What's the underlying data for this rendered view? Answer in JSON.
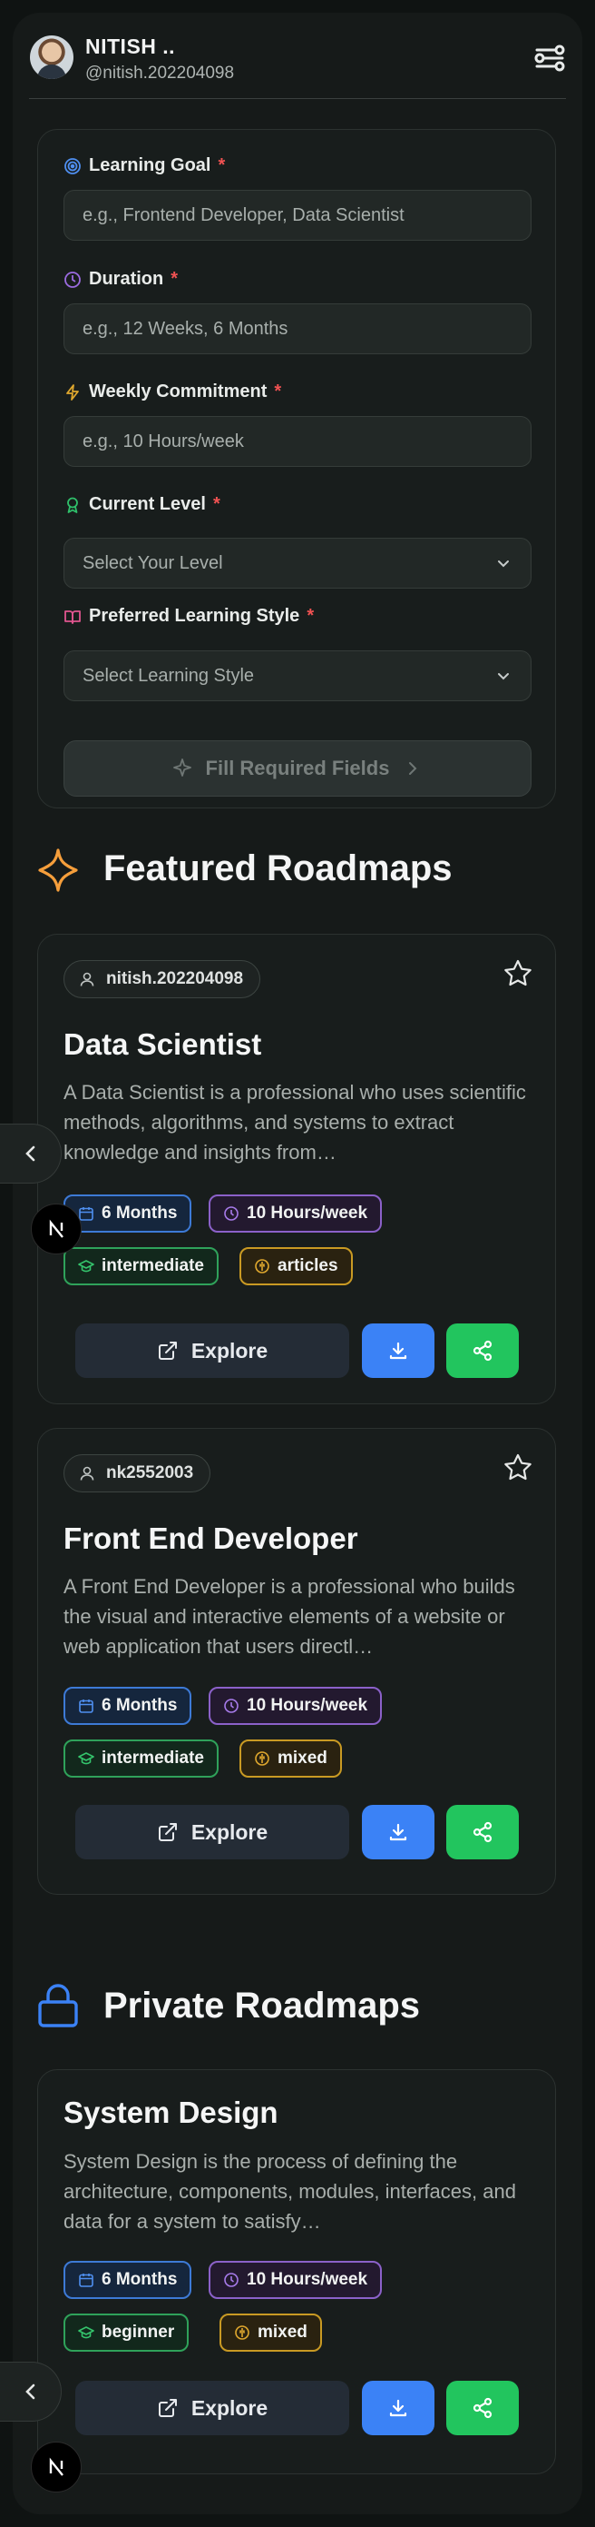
{
  "user": {
    "name": "NITISH ..",
    "handle": "@nitish.202204098"
  },
  "form": {
    "fields": [
      {
        "label": "Learning Goal",
        "required": "*",
        "placeholder": "e.g., Frontend Developer, Data Scientist",
        "icon": "target-icon"
      },
      {
        "label": "Duration",
        "required": "*",
        "placeholder": "e.g., 12 Weeks, 6 Months",
        "icon": "clock-icon"
      },
      {
        "label": "Weekly Commitment",
        "required": "*",
        "placeholder": "e.g., 10 Hours/week",
        "icon": "lightning-icon"
      },
      {
        "label": "Current Level",
        "required": "*",
        "placeholder": "Select Your Level",
        "icon": "award-icon"
      },
      {
        "label": "Preferred Learning Style",
        "required": "*",
        "placeholder": "Select Learning Style",
        "icon": "book-icon"
      }
    ],
    "submit_label": "Fill Required Fields"
  },
  "featured": {
    "title": "Featured Roadmaps",
    "cards": [
      {
        "author": "nitish.202204098",
        "title": "Data Scientist",
        "description": "A Data Scientist is a professional who uses scientific methods, algorithms, and systems to extract knowledge and insights from…",
        "duration": "6 Months",
        "hours": "10 Hours/week",
        "level": "intermediate",
        "style": "articles",
        "explore_label": "Explore"
      },
      {
        "author": "nk2552003",
        "title": "Front End Developer",
        "description": "A Front End Developer is a professional who builds the visual and interactive elements of a website or web application that users directl…",
        "duration": "6 Months",
        "hours": "10 Hours/week",
        "level": "intermediate",
        "style": "mixed",
        "explore_label": "Explore"
      }
    ]
  },
  "private": {
    "title": "Private Roadmaps",
    "cards": [
      {
        "title": "System Design",
        "description": "System Design is the process of defining the architecture, components, modules, interfaces, and data for a system to satisfy…",
        "duration": "6 Months",
        "hours": "10 Hours/week",
        "level": "beginner",
        "style": "mixed",
        "explore_label": "Explore"
      }
    ]
  },
  "colors": {
    "accent_blue": "#3b82f6",
    "accent_green": "#22c55e",
    "featured_icon": "#f59e3b",
    "private_icon": "#3b82f6"
  }
}
